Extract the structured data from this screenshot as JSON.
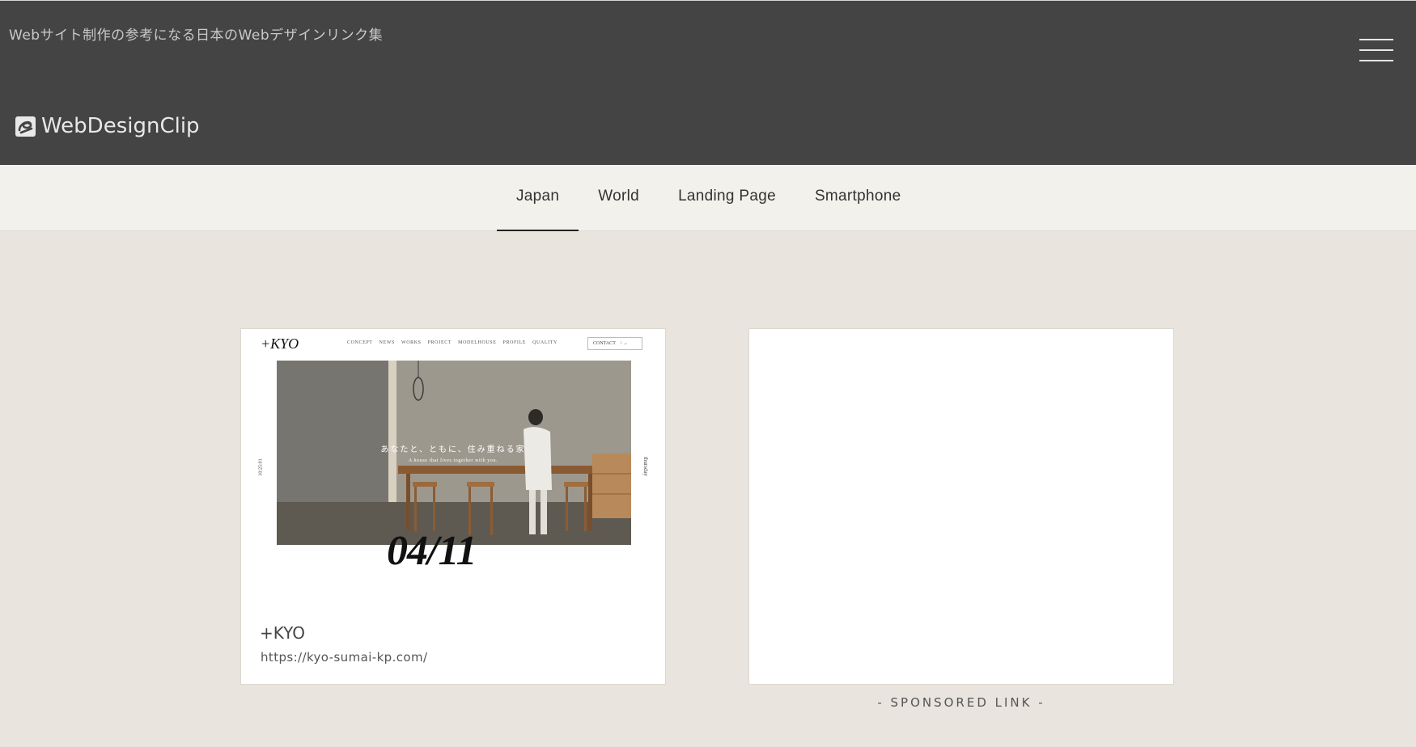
{
  "header": {
    "tagline": "Webサイト制作の参考になる日本のWebデザインリンク集",
    "logo_text": "WebDesignClip",
    "menu_icon": "hamburger-menu-icon"
  },
  "nav": {
    "tabs": [
      {
        "label": "Japan",
        "active": true
      },
      {
        "label": "World",
        "active": false
      },
      {
        "label": "Landing Page",
        "active": false
      },
      {
        "label": "Smartphone",
        "active": false
      }
    ]
  },
  "cards": [
    {
      "name": "+KYO",
      "url": "https://kyo-sumai-kp.com/",
      "thumbnail": {
        "logo": "+KYO",
        "nav_items": [
          "CONCEPT",
          "NEWS",
          "WORKS",
          "PROJECT",
          "MODELHOUSE",
          "PROFILE",
          "QUALITY"
        ],
        "contact": "CONTACT",
        "headline_jp": "あなたと、ともに、住み重ねる家",
        "headline_en": "A house that lives together with you.",
        "side_left": "10:25:01",
        "side_right": "thursday",
        "date": "04/11"
      }
    }
  ],
  "sponsored": {
    "label": "- SPONSORED LINK -"
  }
}
